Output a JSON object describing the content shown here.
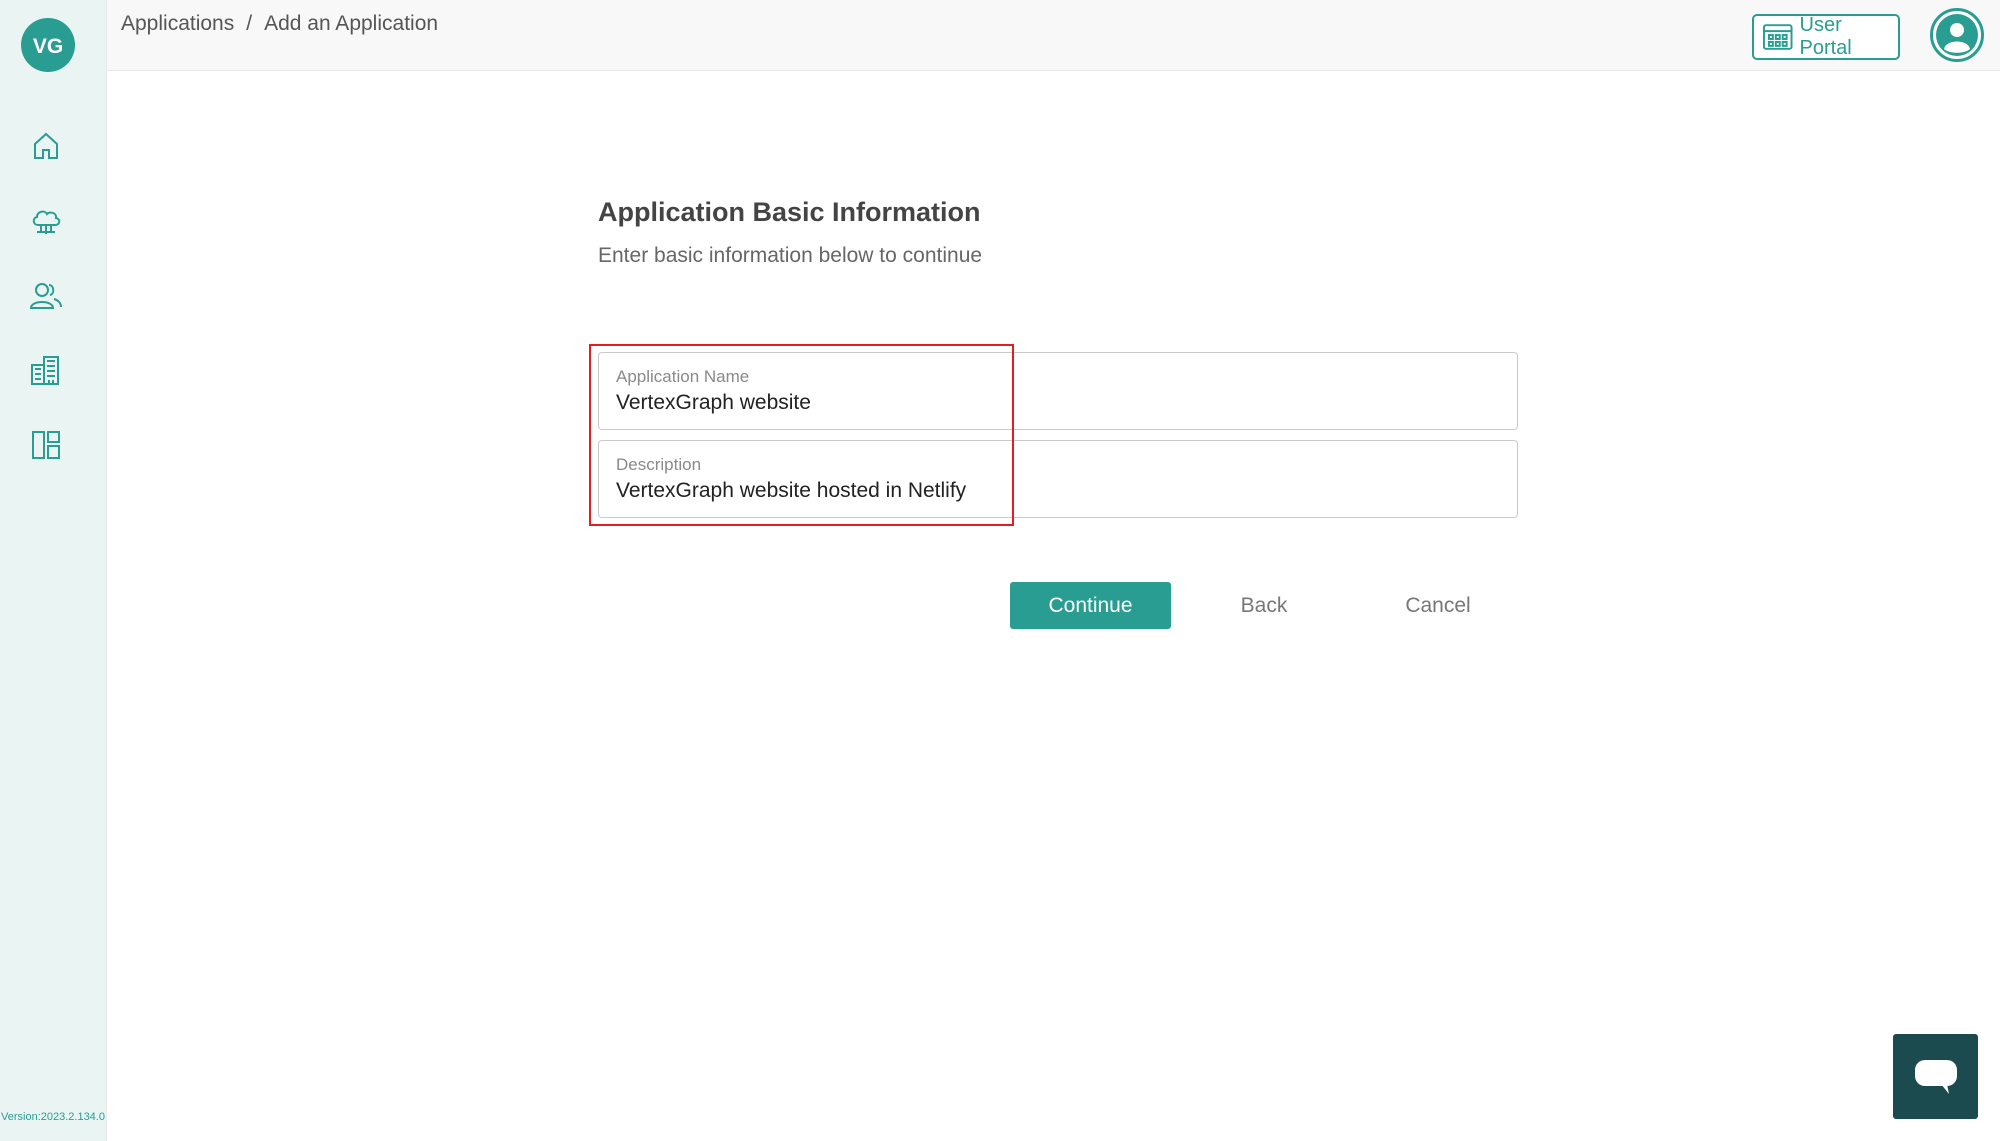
{
  "app": {
    "logo_text": "VG",
    "version": "Version:2023.2.134.0",
    "brand_color": "#2a9d92"
  },
  "sidebar": {
    "items": [
      {
        "icon": "home-icon"
      },
      {
        "icon": "cloud-network-icon"
      },
      {
        "icon": "users-icon"
      },
      {
        "icon": "buildings-icon"
      },
      {
        "icon": "layout-dashboard-icon"
      }
    ]
  },
  "header": {
    "breadcrumb": {
      "root": "Applications",
      "separator": "/",
      "current": "Add an Application"
    },
    "user_portal_label": "User Portal",
    "user_portal_icon": "app-grid-icon",
    "avatar_icon": "user-avatar-icon"
  },
  "form": {
    "title": "Application Basic Information",
    "subtitle": "Enter basic information below to continue",
    "fields": [
      {
        "label": "Application Name",
        "value": "VertexGraph website"
      },
      {
        "label": "Description",
        "value": "VertexGraph website hosted in Netlify"
      }
    ],
    "highlight_color": "#e02020",
    "buttons": {
      "continue": "Continue",
      "back": "Back",
      "cancel": "Cancel"
    }
  },
  "chat": {
    "icon": "chat-bubble-icon",
    "color": "#1b4a4f"
  }
}
